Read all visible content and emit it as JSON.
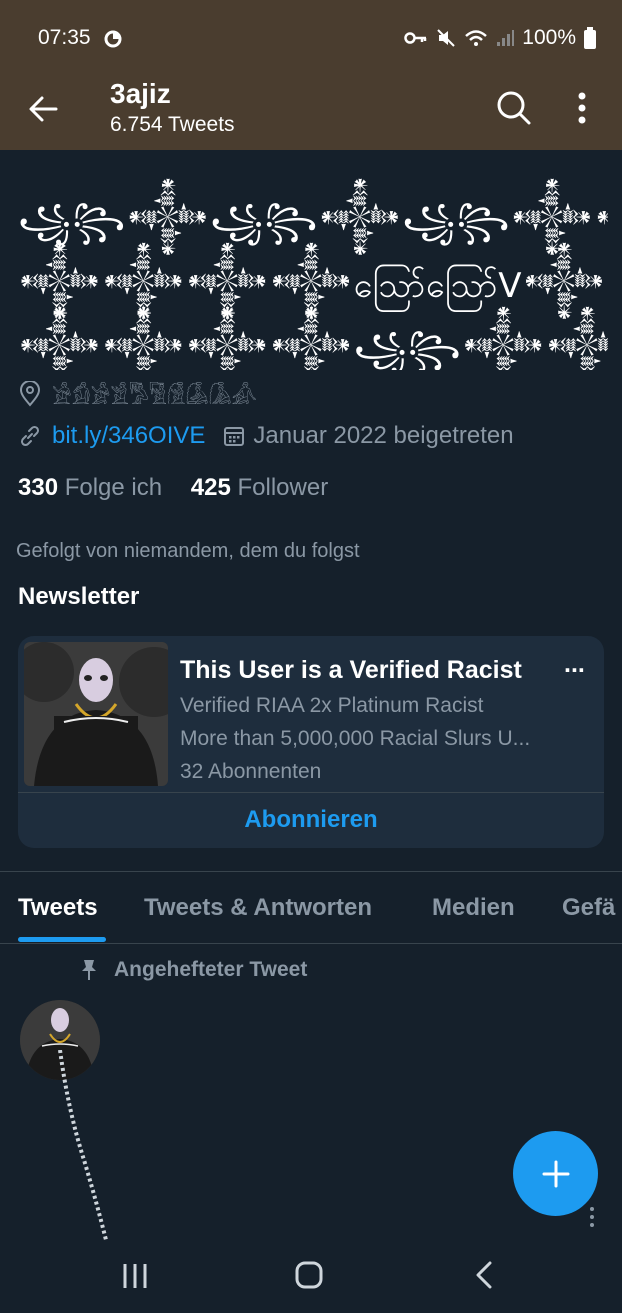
{
  "status_bar": {
    "time": "07:35",
    "battery": "100%"
  },
  "header": {
    "title": "3ajiz",
    "subtitle": "6.754 Tweets"
  },
  "bio": {
    "lines": [
      "꧁꧂𒀱꧁꧂𒀱꧁꧂𒀱𒀱𒀱𒀱꧁꧂",
      "𒀱𒀱𒀱𒀱ဪဪV𒀱𒀱𒀱𒀱",
      "𒀱𒀱𒀱𒀱꧁꧂𒀱𒀱𒀱𒀱"
    ]
  },
  "profile": {
    "location": "𓀀𓀁𓀂𓀃𓀄𓀅𓀆𓀇𓀈𓀉",
    "link": "bit.ly/346OIVE",
    "joined": "Januar 2022 beigetreten",
    "following_count": "330",
    "following_label": "Folge ich",
    "followers_count": "425",
    "followers_label": "Follower",
    "followed_by": "Gefolgt von niemandem, dem du folgst"
  },
  "newsletter": {
    "heading": "Newsletter",
    "title": "This User is a Verified Racist",
    "more": "...",
    "desc1": "Verified RIAA 2x Platinum Racist",
    "desc2": "More than 5,000,000 Racial Slurs U...",
    "subscribers": "32 Abonnenten",
    "subscribe_label": "Abonnieren"
  },
  "tabs": [
    {
      "label": "Tweets"
    },
    {
      "label": "Tweets & Antworten"
    },
    {
      "label": "Medien"
    },
    {
      "label": "Gefä"
    }
  ],
  "pinned": {
    "label": "Angehefteter Tweet"
  },
  "colors": {
    "accent": "#1d9bf0",
    "background": "#15202b",
    "header_bg": "#4a3d2f",
    "card_bg": "#1e2d3d"
  }
}
